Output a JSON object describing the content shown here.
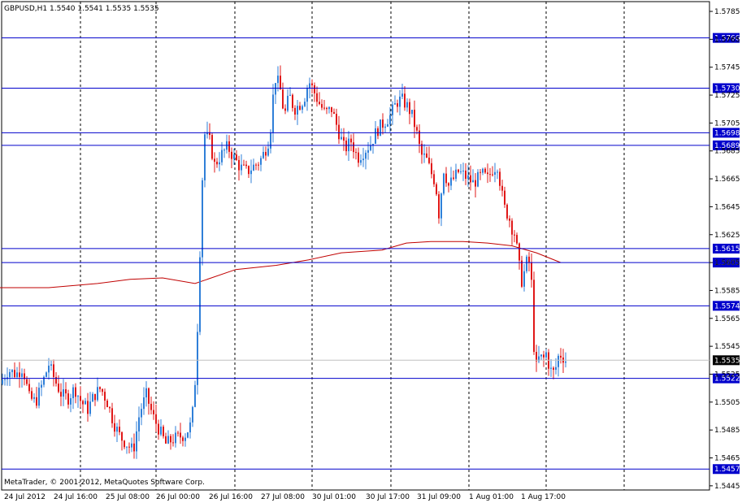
{
  "chart_data": {
    "type": "candlestick",
    "symbol_header": "GBPUSD,H1  1.5540 1.5541 1.5535 1.5535",
    "footer_text": "MetaTrader, © 2001-2012, MetaQuotes Software Corp.",
    "ylim": [
      1.5442,
      1.5792
    ],
    "y_ticks": [
      "1.5785",
      "1.5765",
      "1.5745",
      "1.5725",
      "1.5705",
      "1.5685",
      "1.5665",
      "1.5645",
      "1.5625",
      "1.5605",
      "1.5585",
      "1.5565",
      "1.5545",
      "1.5525",
      "1.5505",
      "1.5485",
      "1.5465",
      "1.5445"
    ],
    "x_labels": [
      "24 Jul 2012",
      "24 Jul 16:00",
      "25 Jul 08:00",
      "26 Jul 00:00",
      "26 Jul 16:00",
      "27 Jul 08:00",
      "30 Jul 01:00",
      "30 Jul 17:00",
      "31 Jul 09:00",
      "1 Aug 01:00",
      "1 Aug 17:00"
    ],
    "level_lines": [
      "1.5766",
      "1.5730",
      "1.5698",
      "1.5689",
      "1.5615",
      "1.5605",
      "1.5574",
      "1.5522",
      "1.5457"
    ],
    "current_price": "1.5535",
    "candle_anchors": [
      [
        0,
        1.5518
      ],
      [
        10,
        1.5528
      ],
      [
        20,
        1.5525
      ],
      [
        28,
        1.553
      ],
      [
        36,
        1.5508
      ],
      [
        44,
        1.5505
      ],
      [
        52,
        1.5518
      ],
      [
        60,
        1.5532
      ],
      [
        68,
        1.552
      ],
      [
        76,
        1.551
      ],
      [
        84,
        1.5508
      ],
      [
        92,
        1.5515
      ],
      [
        100,
        1.5505
      ],
      [
        108,
        1.55
      ],
      [
        116,
        1.551
      ],
      [
        124,
        1.5515
      ],
      [
        132,
        1.5505
      ],
      [
        140,
        1.549
      ],
      [
        148,
        1.548
      ],
      [
        156,
        1.5475
      ],
      [
        164,
        1.547
      ],
      [
        172,
        1.5498
      ],
      [
        180,
        1.551
      ],
      [
        188,
        1.5495
      ],
      [
        196,
        1.5485
      ],
      [
        204,
        1.5475
      ],
      [
        212,
        1.5478
      ],
      [
        220,
        1.548
      ],
      [
        228,
        1.5482
      ],
      [
        236,
        1.549
      ],
      [
        240,
        1.552
      ],
      [
        244,
        1.5572
      ],
      [
        248,
        1.5655
      ],
      [
        252,
        1.5697
      ],
      [
        258,
        1.5692
      ],
      [
        264,
        1.5675
      ],
      [
        272,
        1.5682
      ],
      [
        280,
        1.5688
      ],
      [
        288,
        1.568
      ],
      [
        296,
        1.5673
      ],
      [
        304,
        1.567
      ],
      [
        312,
        1.5674
      ],
      [
        320,
        1.5678
      ],
      [
        326,
        1.5685
      ],
      [
        332,
        1.5695
      ],
      [
        338,
        1.5738
      ],
      [
        344,
        1.5732
      ],
      [
        350,
        1.571
      ],
      [
        356,
        1.5725
      ],
      [
        362,
        1.5715
      ],
      [
        368,
        1.5718
      ],
      [
        374,
        1.5722
      ],
      [
        380,
        1.5735
      ],
      [
        386,
        1.5728
      ],
      [
        392,
        1.572
      ],
      [
        400,
        1.5712
      ],
      [
        408,
        1.5715
      ],
      [
        416,
        1.57
      ],
      [
        424,
        1.5686
      ],
      [
        432,
        1.5692
      ],
      [
        440,
        1.568
      ],
      [
        448,
        1.5685
      ],
      [
        456,
        1.569
      ],
      [
        464,
        1.57
      ],
      [
        472,
        1.5705
      ],
      [
        480,
        1.571
      ],
      [
        488,
        1.572
      ],
      [
        494,
        1.5722
      ],
      [
        500,
        1.5718
      ],
      [
        506,
        1.5712
      ],
      [
        512,
        1.57
      ],
      [
        518,
        1.5682
      ],
      [
        524,
        1.568
      ],
      [
        530,
        1.567
      ],
      [
        536,
        1.5662
      ],
      [
        540,
        1.564
      ],
      [
        546,
        1.5672
      ],
      [
        552,
        1.566
      ],
      [
        558,
        1.5665
      ],
      [
        564,
        1.567
      ],
      [
        570,
        1.5668
      ],
      [
        576,
        1.5665
      ],
      [
        582,
        1.5662
      ],
      [
        588,
        1.5665
      ],
      [
        594,
        1.5668
      ],
      [
        600,
        1.5665
      ],
      [
        606,
        1.5672
      ],
      [
        612,
        1.5675
      ],
      [
        616,
        1.566
      ],
      [
        620,
        1.5645
      ],
      [
        626,
        1.5638
      ],
      [
        630,
        1.563
      ],
      [
        634,
        1.5625
      ],
      [
        638,
        1.5605
      ],
      [
        642,
        1.5592
      ],
      [
        646,
        1.56
      ],
      [
        650,
        1.561
      ],
      [
        654,
        1.559
      ],
      [
        657,
        1.5545
      ],
      [
        660,
        1.553
      ],
      [
        664,
        1.5538
      ],
      [
        668,
        1.5535
      ],
      [
        672,
        1.554
      ],
      [
        676,
        1.553
      ],
      [
        680,
        1.5525
      ],
      [
        684,
        1.553
      ],
      [
        688,
        1.554
      ],
      [
        692,
        1.5538
      ],
      [
        696,
        1.5535
      ]
    ],
    "moving_average": [
      [
        0,
        1.5587
      ],
      [
        60,
        1.5587
      ],
      [
        120,
        1.559
      ],
      [
        160,
        1.5593
      ],
      [
        200,
        1.5594
      ],
      [
        240,
        1.559
      ],
      [
        290,
        1.56
      ],
      [
        340,
        1.5603
      ],
      [
        380,
        1.5607
      ],
      [
        420,
        1.5612
      ],
      [
        470,
        1.5614
      ],
      [
        500,
        1.5619
      ],
      [
        530,
        1.562
      ],
      [
        570,
        1.562
      ],
      [
        600,
        1.5619
      ],
      [
        630,
        1.5617
      ],
      [
        660,
        1.5612
      ],
      [
        690,
        1.5605
      ]
    ]
  }
}
